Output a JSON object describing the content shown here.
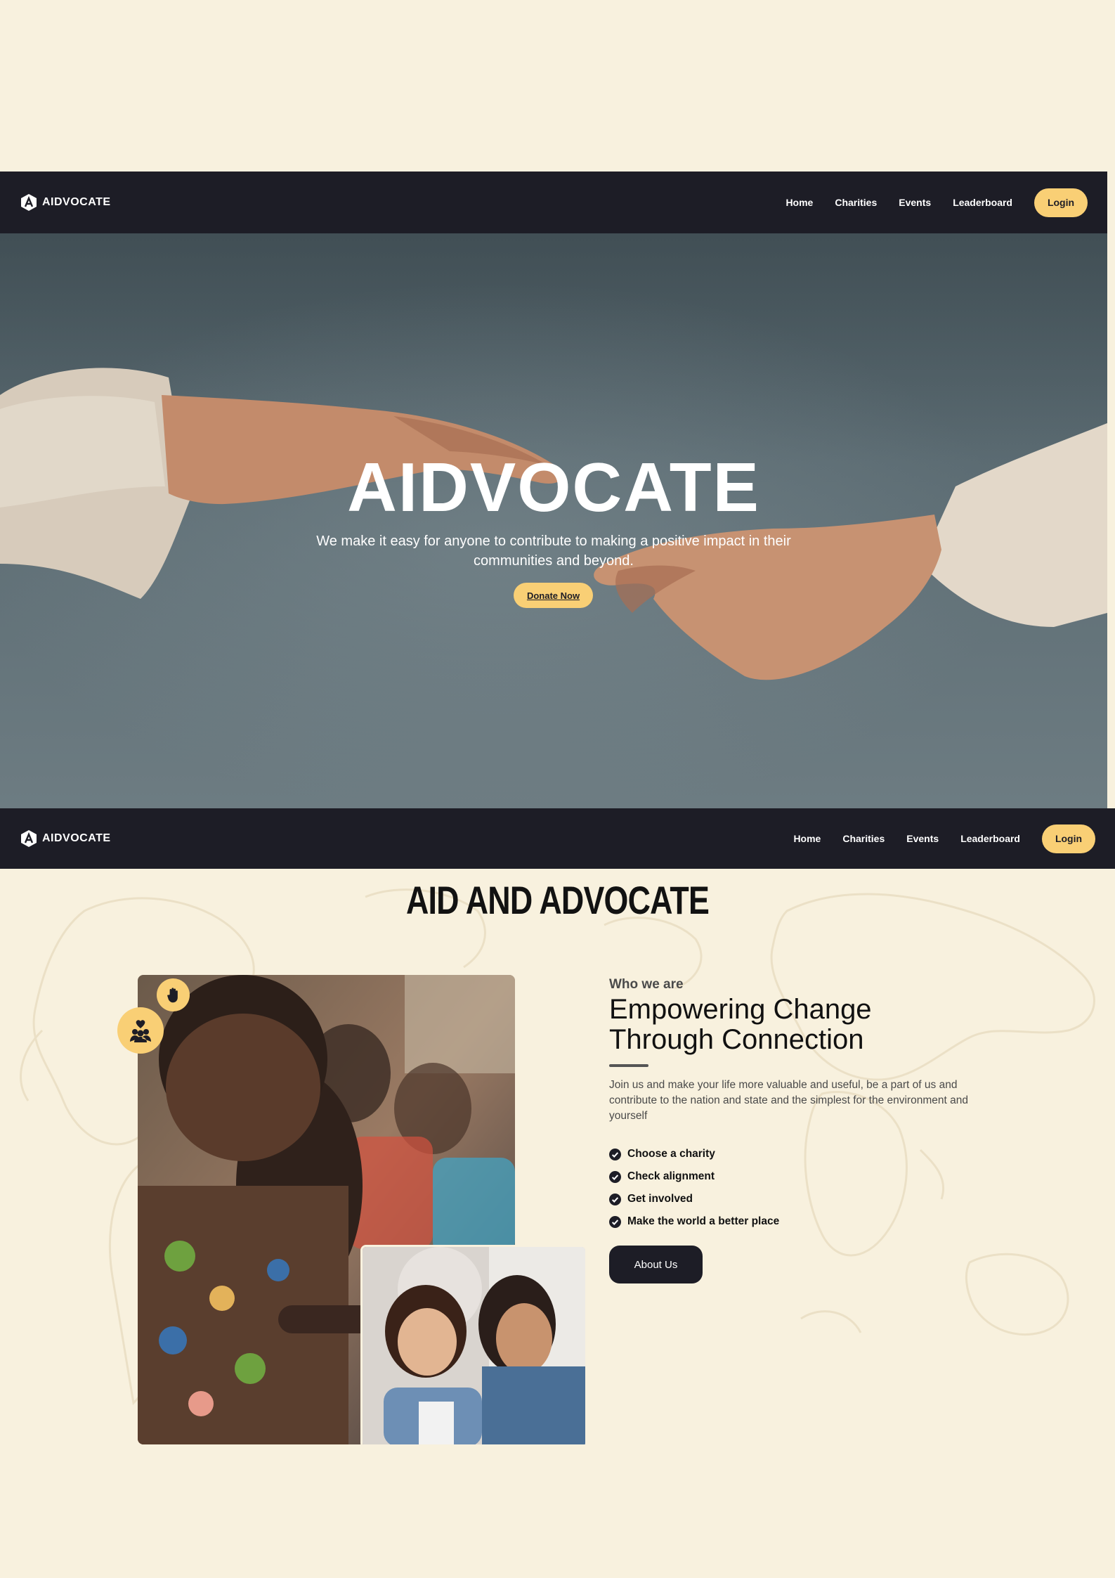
{
  "nav": {
    "brand": "AIDVOCATE",
    "links": [
      "Home",
      "Charities",
      "Events",
      "Leaderboard"
    ],
    "login_label": "Login"
  },
  "hero": {
    "title": "AIDVOCATE",
    "subtitle": "We make it easy for anyone to contribute to making a positive impact in their communities and beyond.",
    "cta_label": "Donate Now"
  },
  "about": {
    "section_title": "AID AND ADVOCATE",
    "eyebrow": "Who we are",
    "headline": "Empowering Change Through Connection",
    "intro": "Join us and make your life more valuable and useful, be a part of us and contribute to the nation and state and the simplest for the environment and yourself",
    "steps": [
      "Choose a charity",
      "Check alignment",
      "Get involved",
      "Make the world a better place"
    ],
    "button_label": "About Us"
  },
  "colors": {
    "page_background": "#f8f1de",
    "nav_background": "#1d1d26",
    "accent": "#f9cf75"
  },
  "icons": {
    "logo": "aidvocate-logo-icon",
    "badge_top": "raised-hand-icon",
    "badge_bottom": "community-heart-icon",
    "list_bullet": "check-circle-icon"
  }
}
